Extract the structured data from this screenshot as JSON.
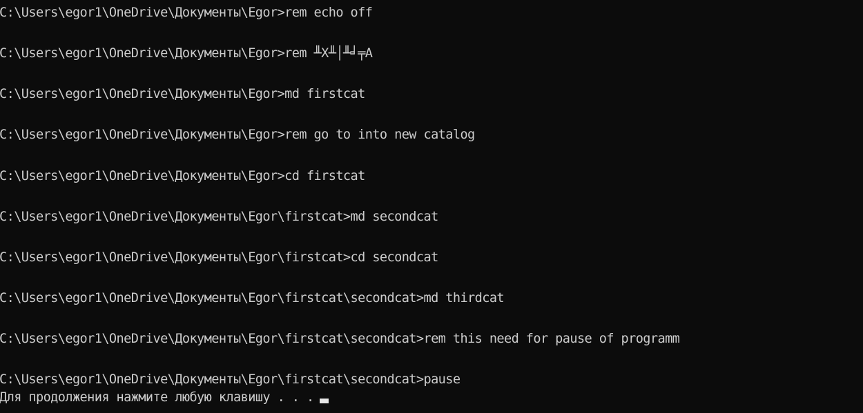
{
  "console": {
    "lines": [
      "C:\\Users\\egor1\\OneDrive\\Документы\\Egor>rem echo off",
      "C:\\Users\\egor1\\OneDrive\\Документы\\Egor>rem ╨Х╨│╨╛╤А",
      "C:\\Users\\egor1\\OneDrive\\Документы\\Egor>md firstcat",
      "C:\\Users\\egor1\\OneDrive\\Документы\\Egor>rem go to into new catalog",
      "C:\\Users\\egor1\\OneDrive\\Документы\\Egor>cd firstcat",
      "C:\\Users\\egor1\\OneDrive\\Документы\\Egor\\firstcat>md secondcat",
      "C:\\Users\\egor1\\OneDrive\\Документы\\Egor\\firstcat>cd secondcat",
      "C:\\Users\\egor1\\OneDrive\\Документы\\Egor\\firstcat\\secondcat>md thirdcat",
      "C:\\Users\\egor1\\OneDrive\\Документы\\Egor\\firstcat\\secondcat>rem this need for pause of programm",
      "C:\\Users\\egor1\\OneDrive\\Документы\\Egor\\firstcat\\secondcat>pause"
    ],
    "pause_message": "Для продолжения нажмите любую клавишу . . ."
  }
}
